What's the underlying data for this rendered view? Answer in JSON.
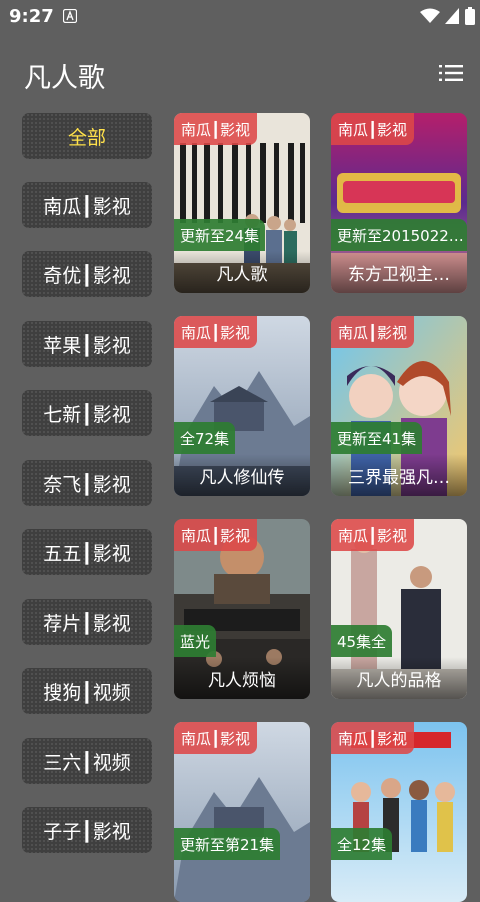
{
  "status_bar": {
    "time": "9:27"
  },
  "header": {
    "title": "凡人歌"
  },
  "sidebar": {
    "items": [
      {
        "label": "全部",
        "active": true
      },
      {
        "label": "南瓜┃影视"
      },
      {
        "label": "奇优┃影视"
      },
      {
        "label": "苹果┃影视"
      },
      {
        "label": "七新┃影视"
      },
      {
        "label": "奈飞┃影视"
      },
      {
        "label": "五五┃影视"
      },
      {
        "label": "荐片┃影视"
      },
      {
        "label": "搜狗┃视频"
      },
      {
        "label": "三六┃视频"
      },
      {
        "label": "子子┃影视"
      }
    ]
  },
  "results": [
    {
      "source": "南瓜┃影视",
      "progress": "更新至24集",
      "title": "凡人歌"
    },
    {
      "source": "南瓜┃影视",
      "progress": "更新至2015022…",
      "title": "东方卫视主…"
    },
    {
      "source": "南瓜┃影视",
      "progress": "全72集",
      "title": "凡人修仙传"
    },
    {
      "source": "南瓜┃影视",
      "progress": "更新至41集",
      "title": "三界最强凡…"
    },
    {
      "source": "南瓜┃影视",
      "progress": "蓝光",
      "title": "凡人烦恼"
    },
    {
      "source": "南瓜┃影视",
      "progress": "45集全",
      "title": "凡人的品格"
    },
    {
      "source": "南瓜┃影视",
      "progress": "更新至第21集",
      "title": ""
    },
    {
      "source": "南瓜┃影视",
      "progress": "全12集",
      "title": ""
    }
  ],
  "colors": {
    "background": "#5f5f5f",
    "active_text": "#ffe14a",
    "source_badge": "#dd4848",
    "progress_badge": "#2e7d32"
  },
  "icons": {
    "menu": "list-menu-icon",
    "wifi": "wifi-icon",
    "signal": "signal-icon",
    "battery": "battery-icon",
    "notification": "notification-icon"
  }
}
